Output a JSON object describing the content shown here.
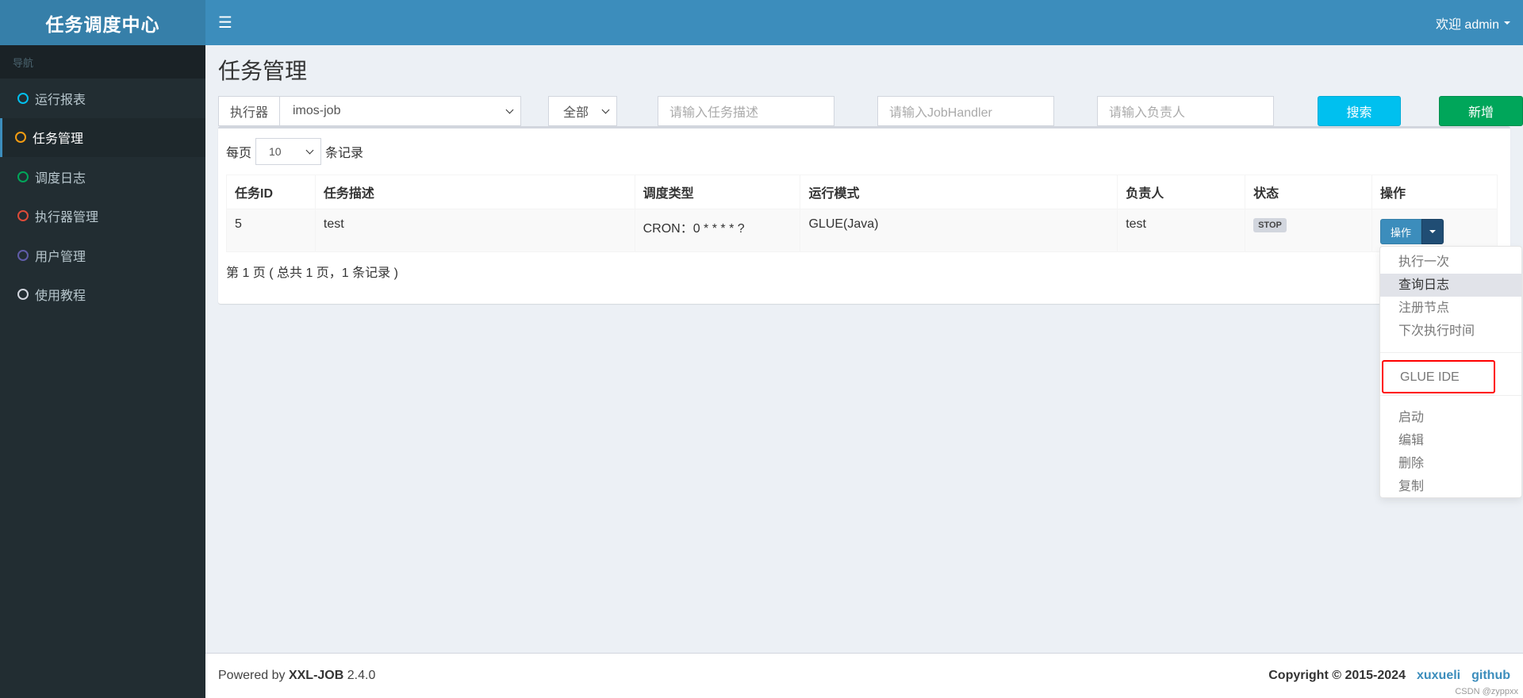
{
  "app": {
    "logo": "任务调度中心",
    "menu_icon": "hamburger-icon",
    "user_greeting": "欢迎 admin"
  },
  "sidebar": {
    "header": "导航",
    "items": [
      {
        "label": "运行报表",
        "color": "#00c0ef",
        "active": false
      },
      {
        "label": "任务管理",
        "color": "#f39c12",
        "active": true
      },
      {
        "label": "调度日志",
        "color": "#00a65a",
        "active": false
      },
      {
        "label": "执行器管理",
        "color": "#dd4b39",
        "active": false
      },
      {
        "label": "用户管理",
        "color": "#605ca8",
        "active": false
      },
      {
        "label": "使用教程",
        "color": "#d2d6de",
        "active": false
      }
    ]
  },
  "page": {
    "title": "任务管理"
  },
  "filters": {
    "executor_label": "执行器",
    "executor_value": "imos-job",
    "status_value": "全部",
    "job_desc_placeholder": "请输入任务描述",
    "job_handler_placeholder": "请输入JobHandler",
    "author_placeholder": "请输入负责人",
    "search_label": "搜索",
    "add_label": "新增"
  },
  "table_controls": {
    "per_page_prefix": "每页",
    "per_page_value": "10",
    "per_page_suffix": "条记录"
  },
  "table": {
    "columns": [
      "任务ID",
      "任务描述",
      "调度类型",
      "运行模式",
      "负责人",
      "状态",
      "操作"
    ],
    "rows": [
      {
        "id": "5",
        "desc": "test",
        "schedule": "CRON：0 * * * * ?",
        "mode": "GLUE(Java)",
        "author": "test",
        "status": "STOP",
        "action_label": "操作"
      }
    ]
  },
  "pagination": {
    "info": "第 1 页 ( 总共 1 页，1 条记录 )"
  },
  "action_menu": {
    "group1": [
      "执行一次",
      "查询日志",
      "注册节点",
      "下次执行时间"
    ],
    "hovered": "查询日志",
    "glue": "GLUE IDE",
    "group2": [
      "启动",
      "编辑",
      "删除",
      "复制"
    ],
    "highlight_color": "#ff0000"
  },
  "footer": {
    "powered_prefix": "Powered by",
    "product": "XXL-JOB",
    "version": "2.4.0",
    "copyright": "Copyright © 2015-2024",
    "link_author": "xuxueli",
    "link_github": "github",
    "watermark": "CSDN @zyppxx"
  }
}
